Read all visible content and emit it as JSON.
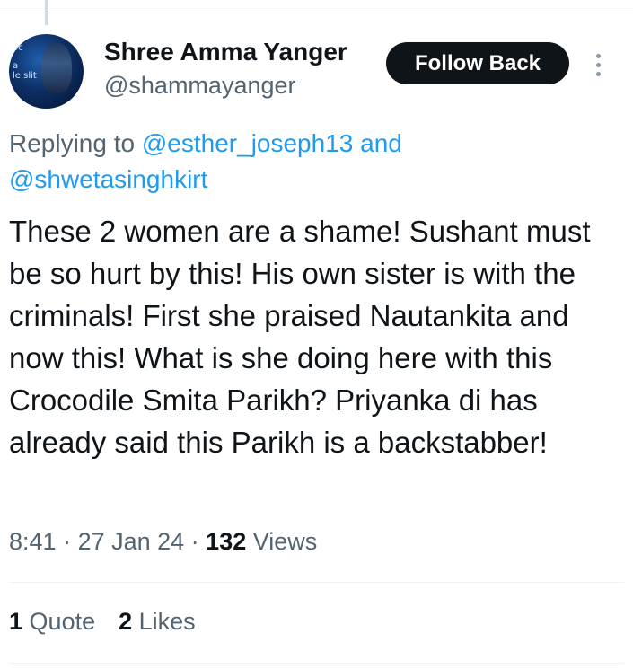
{
  "author": {
    "display_name": "Shree Amma Yanger",
    "handle": "@shammayanger",
    "avatar_text": [
      "oc",
      "a",
      "le slit"
    ]
  },
  "follow_button": {
    "label": "Follow Back"
  },
  "more_menu": {
    "icon": "more-vertical-icon"
  },
  "reply_context": {
    "prefix": "Replying to ",
    "mention_1": "@esther_joseph13",
    "conjunction": " and ",
    "mention_2": "@shwetasinghkirt"
  },
  "tweet": {
    "text": "These 2 women are a shame! Sushant must be so hurt by this! His own sister is with the criminals! First she praised Nautankita and now this! What is she doing here with this Crocodile Smita Parikh? Priyanka di has already said this Parikh is a backstabber!"
  },
  "meta": {
    "time": "8:41",
    "date": "27 Jan 24",
    "views_count": "132",
    "views_label": "Views"
  },
  "stats": {
    "quotes_count": "1",
    "quotes_label": "Quote",
    "likes_count": "2",
    "likes_label": "Likes"
  },
  "colors": {
    "accent": "#1d9bf0",
    "text": "#0f1419",
    "secondary": "#536471",
    "button_bg": "#0f1419"
  }
}
